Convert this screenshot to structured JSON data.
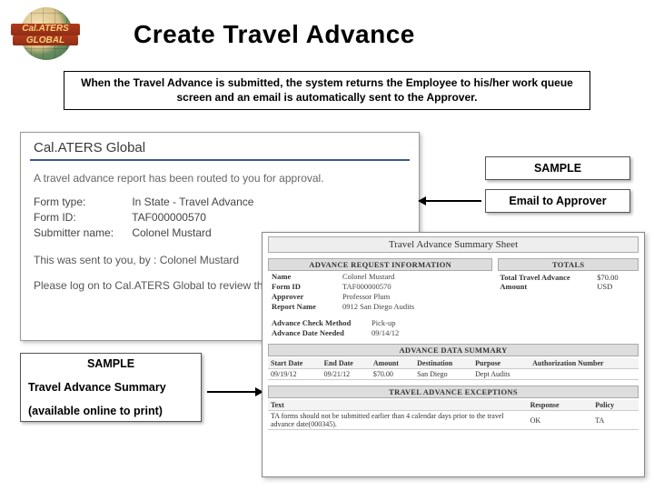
{
  "logo": {
    "line1": "Cal.ATERS",
    "line2": "GLOBAL"
  },
  "title": "Create Travel Advance",
  "intro": "When the Travel Advance is submitted, the system returns the Employee to his/her work queue screen and an email is automatically sent to the Approver.",
  "callouts": {
    "sample": "SAMPLE",
    "email_to_approver": "Email to Approver",
    "sample2": "SAMPLE",
    "summary": "Travel Advance Summary",
    "available": "(available online to print)"
  },
  "email": {
    "brand": "Cal.ATERS Global",
    "routed": "A travel advance report has been routed to you for approval.",
    "fields": {
      "form_type_label": "Form type:",
      "form_type": "In State - Travel Advance",
      "form_id_label": "Form ID:",
      "form_id": "TAF000000570",
      "submitter_label": "Submitter name:",
      "submitter": "Colonel Mustard"
    },
    "sent_by": "This was sent to you, by : Colonel Mustard",
    "login": "Please log on to Cal.ATERS Global to review this fo"
  },
  "summary": {
    "sheet_title": "Travel Advance Summary Sheet",
    "sec_request": "ADVANCE REQUEST INFORMATION",
    "sec_totals": "TOTALS",
    "kv": {
      "name_l": "Name",
      "name": "Colonel Mustard",
      "formid_l": "Form ID",
      "formid": "TAF000000570",
      "approver_l": "Approver",
      "approver": "Professor Plum",
      "report_l": "Report Name",
      "report": "0912 San Diego Audits",
      "check_l": "Advance Check Method",
      "check": "Pick-up",
      "needed_l": "Advance Date Needed",
      "needed": "09/14/12"
    },
    "totals": {
      "label": "Total Travel Advance Amount",
      "amount": "$70.00 USD"
    },
    "sec_data": "ADVANCE DATA SUMMARY",
    "data_headers": [
      "Start Date",
      "End Date",
      "Amount",
      "Destination",
      "Purpose",
      "Authorization Number"
    ],
    "data_row": [
      "09/19/12",
      "09/21/12",
      "$70.00",
      "San Diego",
      "Dept Audits",
      ""
    ],
    "sec_except": "TRAVEL ADVANCE EXCEPTIONS",
    "except_headers": [
      "Text",
      "Response",
      "Policy"
    ],
    "except_row": [
      "TA forms should not be submitted earlier than 4 calendar days prior to the travel advance date(000345).",
      "OK",
      "TA"
    ]
  }
}
